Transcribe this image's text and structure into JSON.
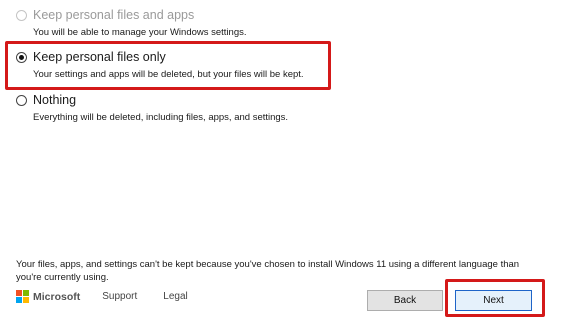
{
  "options": [
    {
      "title": "Keep personal files and apps",
      "description": "You will be able to manage your Windows settings.",
      "state": "disabled"
    },
    {
      "title": "Keep personal files only",
      "description": "Your settings and apps will be deleted, but your files will be kept.",
      "state": "selected"
    },
    {
      "title": "Nothing",
      "description": "Everything will be deleted, including files, apps, and settings.",
      "state": "unselected"
    }
  ],
  "warning_text": "Your files, apps, and settings can't be kept because you've chosen to install  Windows 11 using a different language than you're currently using.",
  "footer": {
    "brand": "Microsoft",
    "support_label": "Support",
    "legal_label": "Legal"
  },
  "buttons": {
    "back_label": "Back",
    "next_label": "Next"
  },
  "colors": {
    "annotation_red": "#d41919",
    "focus_blue": "#1e64c8",
    "logo": [
      "#f25022",
      "#7fba00",
      "#00a4ef",
      "#ffb900"
    ]
  }
}
